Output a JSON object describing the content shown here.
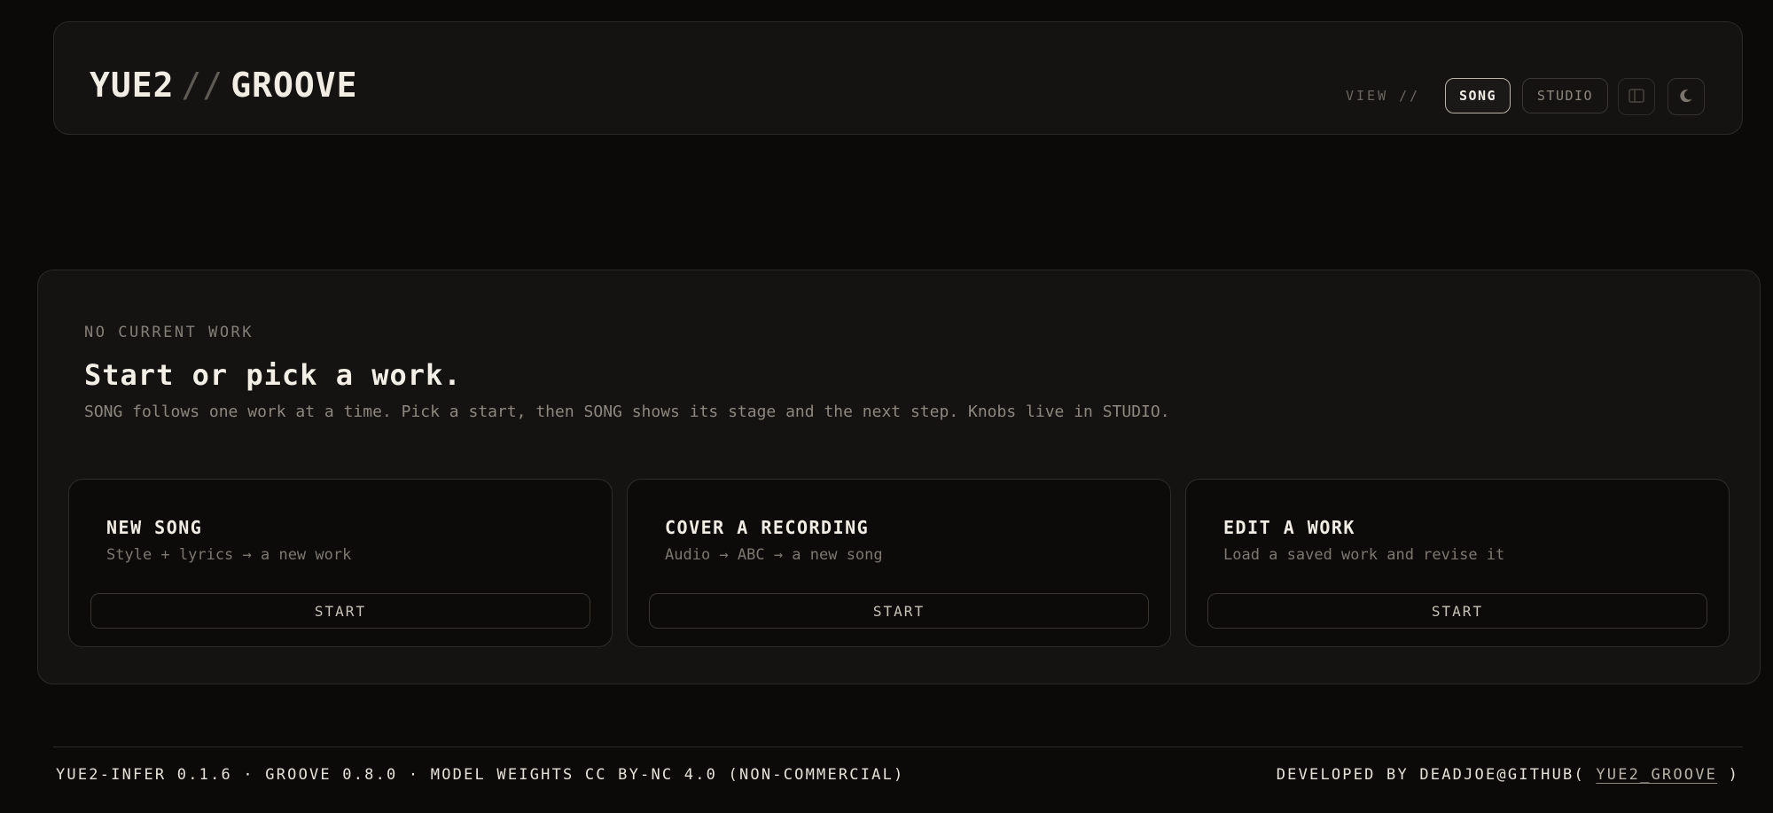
{
  "header": {
    "brand_left": "YUE2",
    "brand_sep": "//",
    "brand_right": "GROOVE",
    "view_label": "VIEW //",
    "tabs": [
      {
        "label": "SONG",
        "active": true
      },
      {
        "label": "STUDIO",
        "active": false
      }
    ],
    "icons": {
      "panel": "sidebar-panel-icon",
      "theme": "moon-icon"
    }
  },
  "main": {
    "eyebrow": "NO CURRENT WORK",
    "title": "Start or pick a work.",
    "description": "SONG follows one work at a time. Pick a start, then SONG shows its stage and the next step. Knobs live in STUDIO.",
    "cards": [
      {
        "title": "NEW SONG",
        "subtitle": "Style + lyrics → a new work",
        "button": "START"
      },
      {
        "title": "COVER A RECORDING",
        "subtitle": "Audio → ABC → a new song",
        "button": "START"
      },
      {
        "title": "EDIT A WORK",
        "subtitle": "Load a saved work and revise it",
        "button": "START"
      }
    ]
  },
  "footer": {
    "left": "YUE2-INFER 0.1.6 · GROOVE 0.8.0 · MODEL WEIGHTS CC BY-NC 4.0 (NON-COMMERCIAL)",
    "right_prefix": "DEVELOPED BY DEADJOE@GITHUB(",
    "right_link": "YUE2_GROOVE",
    "right_suffix": ")"
  },
  "colors": {
    "background": "#0b0a09",
    "surface": "#141312",
    "card": "#0c0b0a",
    "border": "#2c2a27",
    "text": "#ece8df",
    "muted": "#847f77"
  }
}
